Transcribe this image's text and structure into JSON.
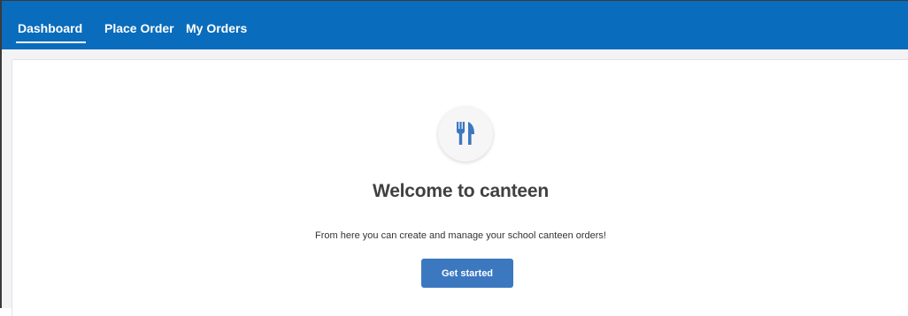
{
  "nav": {
    "tabs": [
      {
        "label": "Dashboard",
        "active": true
      },
      {
        "label": "Place Order",
        "active": false
      },
      {
        "label": "My Orders",
        "active": false
      }
    ]
  },
  "main": {
    "icon": "cutlery-icon",
    "title": "Welcome to canteen",
    "subtitle": "From here you can create and manage your school canteen orders!",
    "cta_label": "Get started"
  },
  "colors": {
    "navbar": "#0a6cbc",
    "accent_icon": "#3b78c0",
    "button": "#3b78c0",
    "page_bg": "#f3f3f5"
  }
}
